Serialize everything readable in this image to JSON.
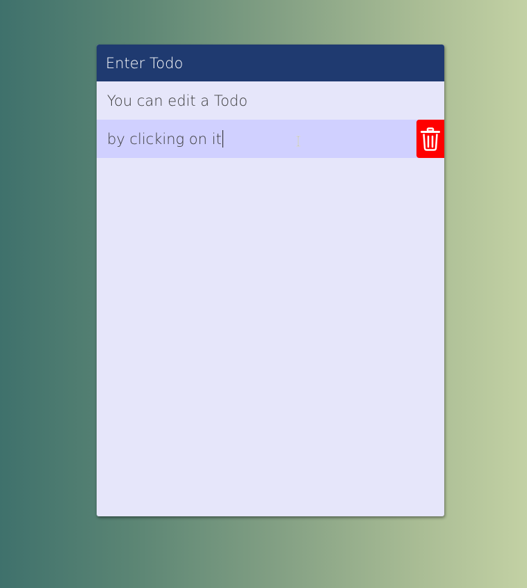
{
  "header": {
    "placeholder": "Enter Todo"
  },
  "todos": [
    {
      "text": "You can edit a Todo"
    },
    {
      "text": "by clicking on it"
    }
  ],
  "colors": {
    "header_bg": "#1f3a70",
    "card_bg": "#e6e6fa",
    "selected_bg": "#d0d0ff",
    "delete_bg": "#ff0000"
  },
  "icons": {
    "delete": "trash-icon",
    "cursor": "text-cursor-icon"
  }
}
